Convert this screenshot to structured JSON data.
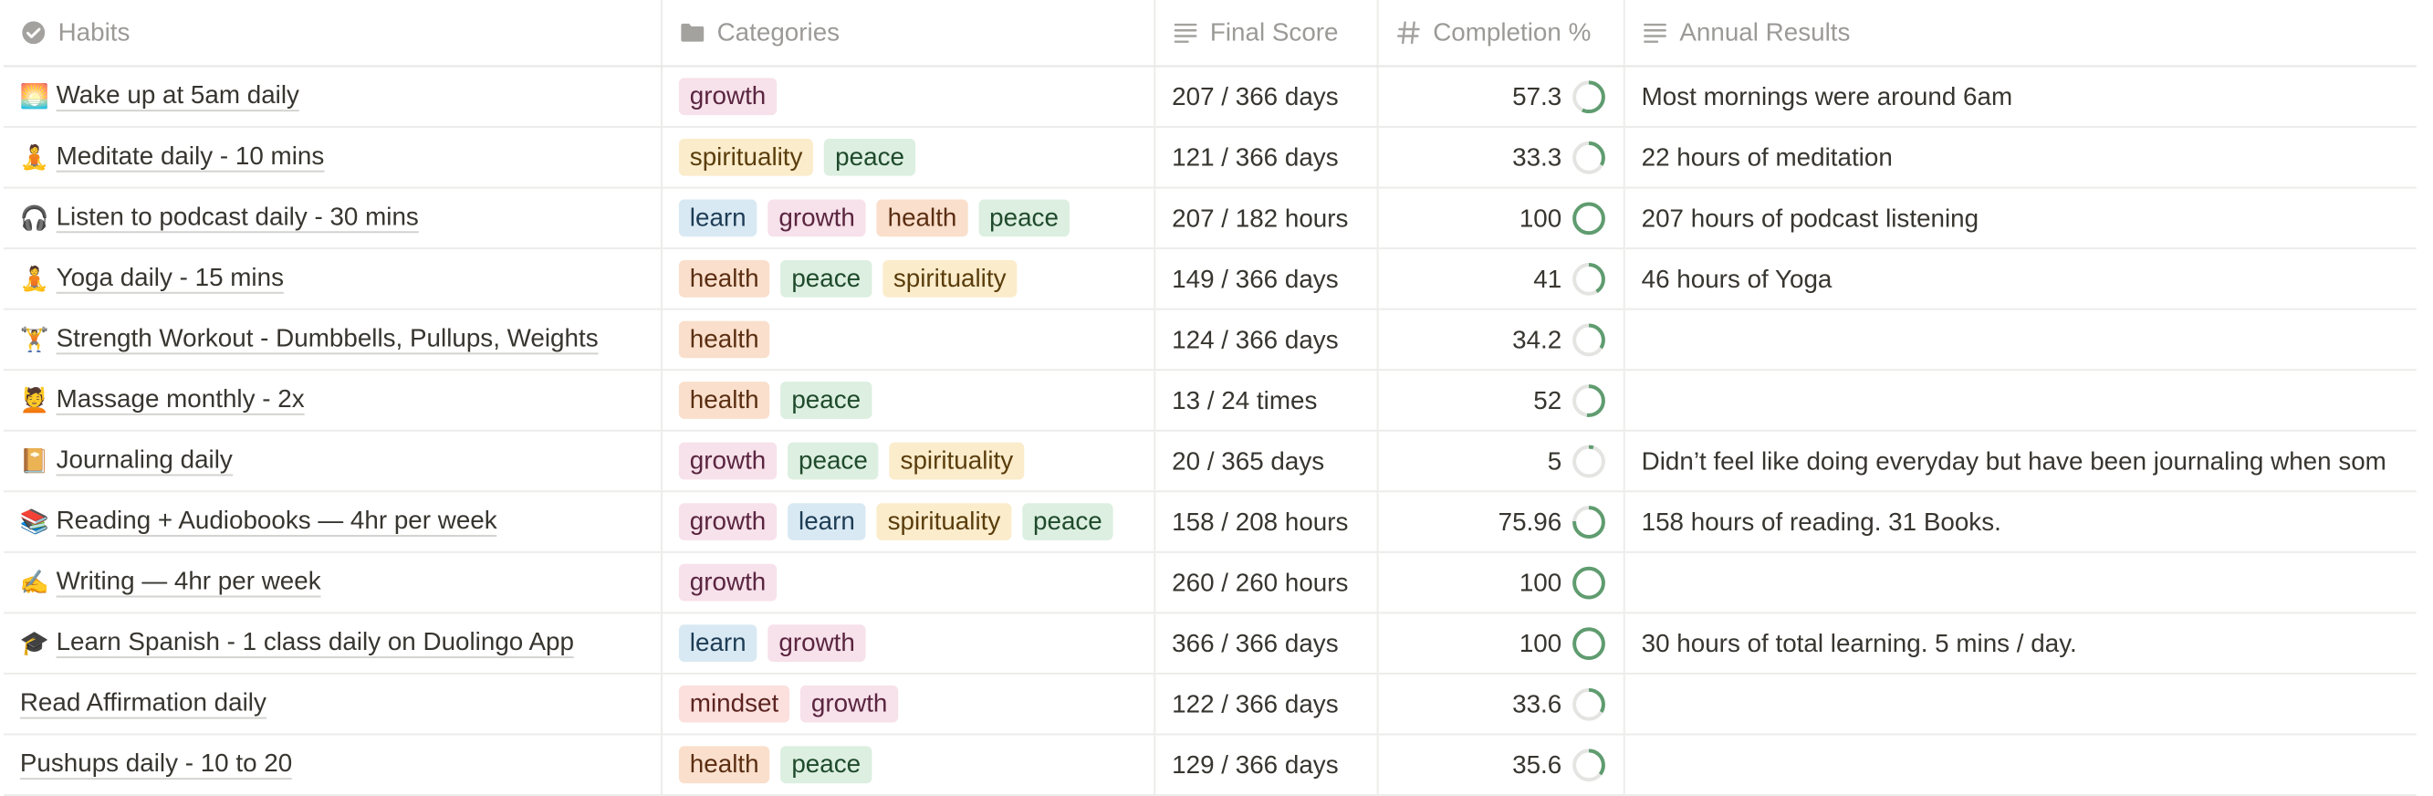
{
  "columns": {
    "habits": "Habits",
    "categories": "Categories",
    "final_score": "Final Score",
    "completion": "Completion %",
    "annual_results": "Annual Results"
  },
  "icons": {
    "habits": "check-circle-icon",
    "categories": "folder-icon",
    "final_score": "text-lines-icon",
    "completion": "hash-icon",
    "annual_results": "text-lines-icon"
  },
  "colors": {
    "progress_ring": "#5f9c6f",
    "progress_track": "#e4e4e2"
  },
  "rows": [
    {
      "emoji": "🌅",
      "name": "Wake up at 5am daily",
      "categories": [
        "growth"
      ],
      "score": "207 / 366 days",
      "completion": "57.3",
      "completion_fraction": 0.573,
      "result": "Most mornings were around 6am"
    },
    {
      "emoji": "🧘",
      "name": "Meditate daily - 10 mins",
      "categories": [
        "spirituality",
        "peace"
      ],
      "score": "121 / 366 days",
      "completion": "33.3",
      "completion_fraction": 0.333,
      "result": "22 hours of meditation"
    },
    {
      "emoji": "🎧",
      "name": "Listen to podcast daily - 30 mins",
      "categories": [
        "learn",
        "growth",
        "health",
        "peace"
      ],
      "score": "207 / 182 hours",
      "completion": "100",
      "completion_fraction": 1.0,
      "result": "207 hours of podcast listening"
    },
    {
      "emoji": "🧘",
      "name": "Yoga daily - 15 mins",
      "categories": [
        "health",
        "peace",
        "spirituality"
      ],
      "score": "149 / 366 days",
      "completion": "41",
      "completion_fraction": 0.41,
      "result": "46 hours of Yoga"
    },
    {
      "emoji": "🏋️",
      "name": "Strength Workout - Dumbbells, Pullups, Weights",
      "categories": [
        "health"
      ],
      "score": "124 / 366 days",
      "completion": "34.2",
      "completion_fraction": 0.342,
      "result": ""
    },
    {
      "emoji": "💆",
      "name": "Massage monthly - 2x",
      "categories": [
        "health",
        "peace"
      ],
      "score": "13 / 24 times",
      "completion": "52",
      "completion_fraction": 0.52,
      "result": ""
    },
    {
      "emoji": "📔",
      "name": "Journaling daily",
      "categories": [
        "growth",
        "peace",
        "spirituality"
      ],
      "score": "20 / 365 days",
      "completion": "5",
      "completion_fraction": 0.05,
      "result": "Didn’t feel like doing everyday but have been journaling when som"
    },
    {
      "emoji": "📚",
      "name": "Reading + Audiobooks — 4hr per week",
      "categories": [
        "growth",
        "learn",
        "spirituality",
        "peace"
      ],
      "score": "158 / 208 hours",
      "completion": "75.96",
      "completion_fraction": 0.7596,
      "result": "158 hours of reading. 31 Books."
    },
    {
      "emoji": "✍️",
      "name": "Writing — 4hr per week",
      "categories": [
        "growth"
      ],
      "score": "260 / 260 hours",
      "completion": "100",
      "completion_fraction": 1.0,
      "result": ""
    },
    {
      "emoji": "🎓",
      "name": "Learn Spanish - 1 class daily on Duolingo App",
      "categories": [
        "learn",
        "growth"
      ],
      "score": "366 / 366 days",
      "completion": "100",
      "completion_fraction": 1.0,
      "result": "30 hours of total learning. 5 mins / day."
    },
    {
      "emoji": "",
      "name": "Read Affirmation daily",
      "categories": [
        "mindset",
        "growth"
      ],
      "score": "122 / 366 days",
      "completion": "33.6",
      "completion_fraction": 0.336,
      "result": ""
    },
    {
      "emoji": "",
      "name": "Pushups daily - 10 to 20",
      "categories": [
        "health",
        "peace"
      ],
      "score": "129 / 366 days",
      "completion": "35.6",
      "completion_fraction": 0.356,
      "result": ""
    }
  ]
}
